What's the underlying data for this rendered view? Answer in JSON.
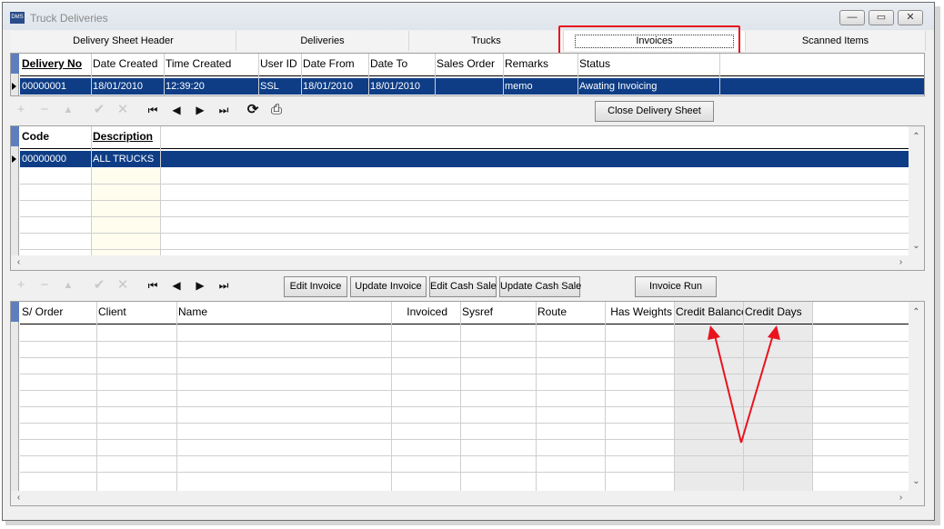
{
  "window": {
    "title": "Truck Deliveries",
    "app_icon_text": "DMS",
    "minimize_glyph": "—",
    "maximize_glyph": "▭",
    "close_glyph": "✕"
  },
  "tabs": [
    {
      "label": "Delivery Sheet Header"
    },
    {
      "label": "Deliveries"
    },
    {
      "label": "Trucks"
    },
    {
      "label": "Invoices"
    },
    {
      "label": "Scanned Items"
    }
  ],
  "delivery_grid": {
    "headers": [
      "Delivery No",
      "Date Created",
      "Time Created",
      "User ID",
      "Date From",
      "Date To",
      "Sales Order",
      "Remarks",
      "Status"
    ],
    "rows": [
      [
        "00000001",
        "18/01/2010",
        "12:39:20",
        "SSL",
        "18/01/2010",
        "18/01/2010",
        "",
        "memo",
        "Awating Invoicing"
      ]
    ]
  },
  "nav_toolbar_1": {
    "close_delivery_sheet": "Close Delivery Sheet"
  },
  "truck_grid": {
    "headers": [
      "Code",
      "Description"
    ],
    "rows": [
      [
        "00000000",
        "ALL TRUCKS"
      ]
    ]
  },
  "invoice_toolbar": {
    "edit_invoice": "Edit Invoice",
    "update_invoice": "Update Invoice",
    "edit_cash_sale": "Edit Cash Sale",
    "update_cash_sale": "Update Cash Sale",
    "invoice_run": "Invoice Run"
  },
  "invoice_grid": {
    "headers": [
      "S/ Order",
      "Client",
      "Name",
      "Invoiced",
      "Sysref",
      "Route",
      "Has Weights",
      "Credit Balance",
      "Credit Days"
    ]
  },
  "colors": {
    "selection": "#0e3d86",
    "annotation": "#e8141e"
  },
  "icons": {
    "add": "+",
    "delete": "−",
    "up": "▲",
    "post": "✔",
    "cancel": "✕",
    "first": "⏮",
    "prior": "◀",
    "next": "▶",
    "last": "⏭",
    "refresh": "⟳",
    "print": "⎙"
  }
}
